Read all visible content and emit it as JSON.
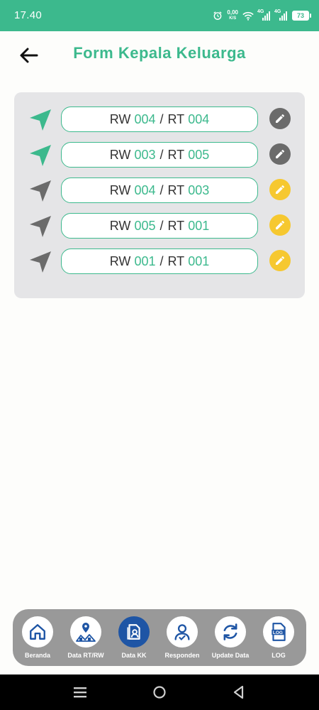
{
  "status_bar": {
    "time": "17.40",
    "net_speed_value": "0,00",
    "net_speed_unit": "K/S",
    "sig1_label": "4G",
    "sig2_label": "4G",
    "battery": "73"
  },
  "header": {
    "title": "Form Kepala Keluarga"
  },
  "rows": [
    {
      "rw_label": "RW",
      "rw": "004",
      "sep": "/",
      "rt_label": "RT",
      "rt": "004",
      "sent": true,
      "editable": false
    },
    {
      "rw_label": "RW",
      "rw": "003",
      "sep": "/",
      "rt_label": "RT",
      "rt": "005",
      "sent": true,
      "editable": false
    },
    {
      "rw_label": "RW",
      "rw": "004",
      "sep": "/",
      "rt_label": "RT",
      "rt": "003",
      "sent": false,
      "editable": true
    },
    {
      "rw_label": "RW",
      "rw": "005",
      "sep": "/",
      "rt_label": "RT",
      "rt": "001",
      "sent": false,
      "editable": true
    },
    {
      "rw_label": "RW",
      "rw": "001",
      "sep": "/",
      "rt_label": "RT",
      "rt": "001",
      "sent": false,
      "editable": true
    }
  ],
  "bottom_nav": [
    {
      "label": "Beranda",
      "icon": "home-icon",
      "active": false
    },
    {
      "label": "Data RT/RW",
      "icon": "map-houses-icon",
      "active": false
    },
    {
      "label": "Data KK",
      "icon": "family-card-icon",
      "active": true
    },
    {
      "label": "Responden",
      "icon": "user-check-icon",
      "active": false
    },
    {
      "label": "Update Data",
      "icon": "sync-icon",
      "active": false
    },
    {
      "label": "LOG",
      "icon": "log-file-icon",
      "active": false
    }
  ],
  "colors": {
    "accent": "#3cb98d",
    "sent_icon": "#3cb98d",
    "pending_icon": "#6b6b6b",
    "edit_locked": "#6b6b6b",
    "edit_active": "#f6c830",
    "nav_active": "#1e55a5",
    "nav_icon": "#1e55a5"
  }
}
